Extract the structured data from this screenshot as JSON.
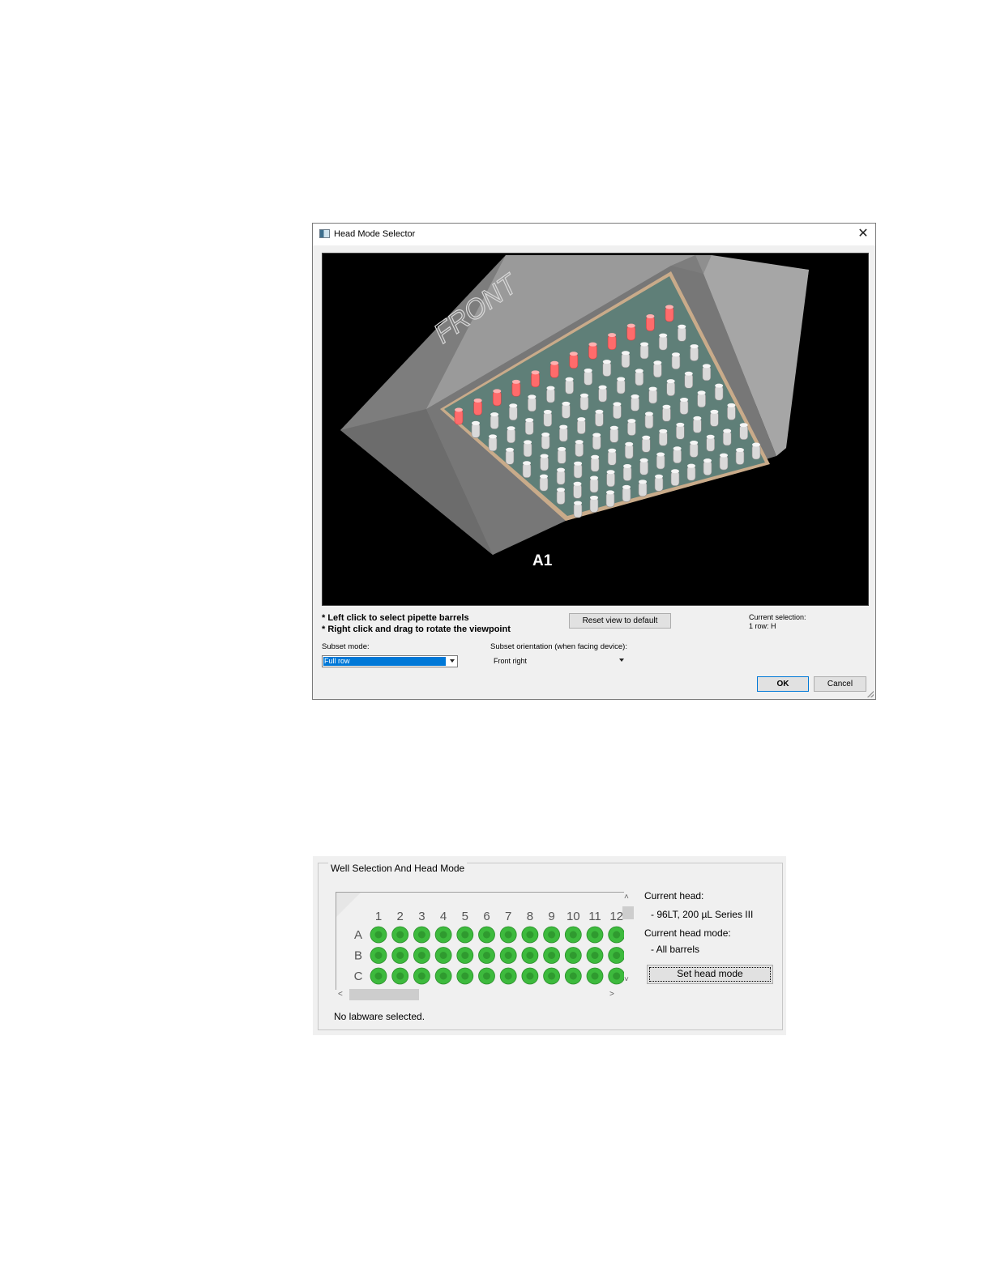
{
  "dialog": {
    "title": "Head Mode Selector",
    "close_icon": "close-icon",
    "viewport_label": "A1",
    "front_label": "FRONT",
    "hint_left_click": "* Left click to select pipette barrels",
    "hint_right_click": "* Right click and drag to rotate the viewpoint",
    "reset_button": "Reset view to default",
    "current_selection_label": "Current selection:",
    "current_selection_value": "1 row: H",
    "subset_mode_label": "Subset mode:",
    "subset_mode_value": "Full row",
    "subset_orientation_label": "Subset orientation (when facing device):",
    "subset_orientation_value": "Front right",
    "ok_button": "OK",
    "cancel_button": "Cancel",
    "colors": {
      "selected_barrel": "#ff6b6b",
      "barrel": "#d9d9d9",
      "housing": "#8a8a8a",
      "plate": "#5f7f78"
    }
  },
  "well_panel": {
    "title": "Well Selection And Head Mode",
    "columns": [
      "1",
      "2",
      "3",
      "4",
      "5",
      "6",
      "7",
      "8",
      "9",
      "10",
      "11",
      "12"
    ],
    "rows": [
      "A",
      "B",
      "C"
    ],
    "well_color": "#3dba3d",
    "status": "No labware selected.",
    "current_head_label": "Current head:",
    "current_head_value": "- 96LT, 200 µL Series III",
    "current_head_mode_label": "Current head mode:",
    "current_head_mode_value": "- All barrels",
    "set_head_mode_button": "Set head mode"
  }
}
